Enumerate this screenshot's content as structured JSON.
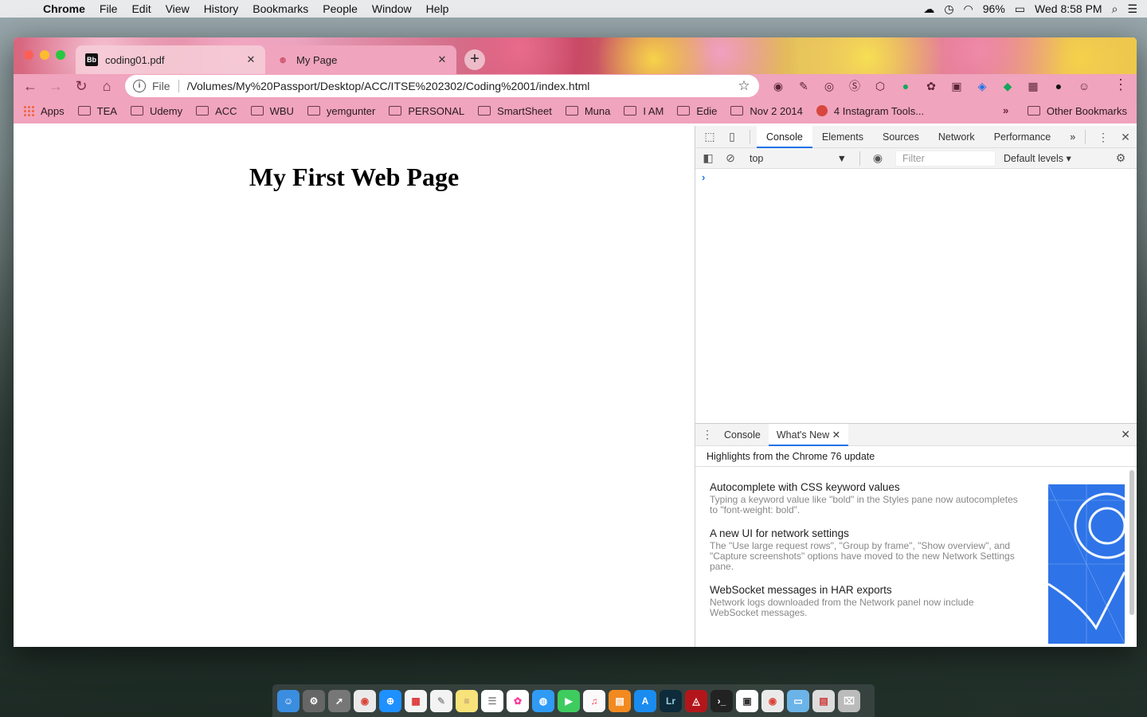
{
  "menubar": {
    "app": "Chrome",
    "items": [
      "File",
      "Edit",
      "View",
      "History",
      "Bookmarks",
      "People",
      "Window",
      "Help"
    ],
    "battery": "96%",
    "clock": "Wed 8:58 PM"
  },
  "tabs": [
    {
      "title": "coding01.pdf",
      "favicon": "Bb"
    },
    {
      "title": "My Page",
      "favicon": "globe-icon"
    }
  ],
  "omnibox": {
    "scheme_label": "File",
    "url": "/Volumes/My%20Passport/Desktop/ACC/ITSE%202302/Coding%2001/index.html"
  },
  "bookmarks": {
    "items": [
      "Apps",
      "TEA",
      "Udemy",
      "ACC",
      "WBU",
      "yemgunter",
      "PERSONAL",
      "SmartSheet",
      "Muna",
      "I AM",
      "Edie",
      "Nov 2 2014",
      "4 Instagram Tools..."
    ],
    "overflow": "»",
    "other": "Other Bookmarks"
  },
  "page": {
    "heading": "My First Web Page"
  },
  "devtools": {
    "tabs": [
      "Console",
      "Elements",
      "Sources",
      "Network",
      "Performance"
    ],
    "more": "»",
    "context": "top",
    "filter_placeholder": "Filter",
    "levels": "Default levels ▾",
    "prompt": "›",
    "drawer_tabs": [
      "Console",
      "What's New"
    ],
    "highlights": "Highlights from the Chrome 76 update",
    "whats_new": [
      {
        "title": "Autocomplete with CSS keyword values",
        "desc": "Typing a keyword value like \"bold\" in the Styles pane now autocompletes to \"font-weight: bold\"."
      },
      {
        "title": "A new UI for network settings",
        "desc": "The \"Use large request rows\", \"Group by frame\", \"Show overview\", and \"Capture screenshots\" options have moved to the new Network Settings pane."
      },
      {
        "title": "WebSocket messages in HAR exports",
        "desc": "Network logs downloaded from the Network panel now include WebSocket messages."
      }
    ]
  },
  "colors": {
    "toolbar": "#f0a4bd",
    "devtools_accent": "#1a73e8"
  }
}
